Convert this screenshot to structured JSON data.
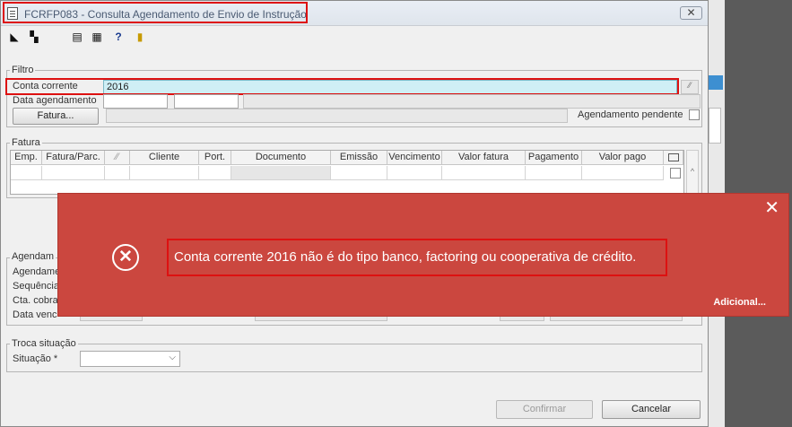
{
  "window": {
    "title": "FCRFP083 - Consulta Agendamento de Envio de Instrução",
    "close_glyph": "✕"
  },
  "toolbar": {
    "icons": [
      "arrow-left-icon",
      "copy-icon",
      "print-icon",
      "grid-icon",
      "help-icon",
      "exit-door-icon"
    ]
  },
  "filtro": {
    "legend": "Filtro",
    "conta_corrente_label": "Conta corrente",
    "conta_corrente_value": "2016",
    "data_agendamento_label": "Data agendamento",
    "fatura_button": "Fatura...",
    "agendamento_pendente_label": "Agendamento pendente"
  },
  "fatura": {
    "legend": "Fatura",
    "columns": [
      "Emp.",
      "Fatura/Parc.",
      "",
      "Cliente",
      "Port.",
      "Documento",
      "Emissão",
      "Vencimento",
      "Valor fatura",
      "Pagamento",
      "Valor pago",
      ""
    ]
  },
  "agendamento": {
    "legend": "Agendam",
    "labels": [
      "Agendame",
      "Sequência",
      "Cta. cobra",
      "Data venc"
    ]
  },
  "troca_situacao": {
    "legend": "Troca situação",
    "situacao_label": "Situação *",
    "situacao_value": ""
  },
  "footer": {
    "confirmar_button": "Confirmar",
    "cancelar_button": "Cancelar"
  },
  "toast": {
    "message": "Conta corrente 2016 não é do tipo banco, factoring ou cooperativa de crédito.",
    "link": "Adicional...",
    "close_glyph": "✕",
    "icon_glyph": "✕",
    "color": "#cb473f"
  }
}
